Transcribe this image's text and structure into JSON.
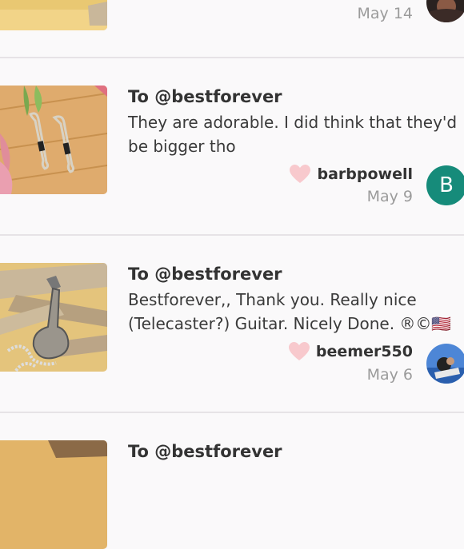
{
  "reviews": [
    {
      "date": "May 14"
    },
    {
      "to": "To @bestforever",
      "message": "They are adorable. I did think that they'd be bigger tho",
      "username": "barbpowell",
      "date": "May 9",
      "avatar_letter": "B",
      "avatar_color": "#168b7a"
    },
    {
      "to": "To @bestforever",
      "message": "Bestforever,, Thank you. Really nice (Telecaster?) Guitar. Nicely Done. ®©🇺🇸",
      "username": "beemer550",
      "date": "May 6"
    },
    {
      "to": "To @bestforever"
    }
  ],
  "icons": {
    "like": "heart-icon"
  },
  "colors": {
    "heart": "#f8c9cd",
    "divider": "#e6e3e6",
    "date": "#9b9b9b"
  }
}
